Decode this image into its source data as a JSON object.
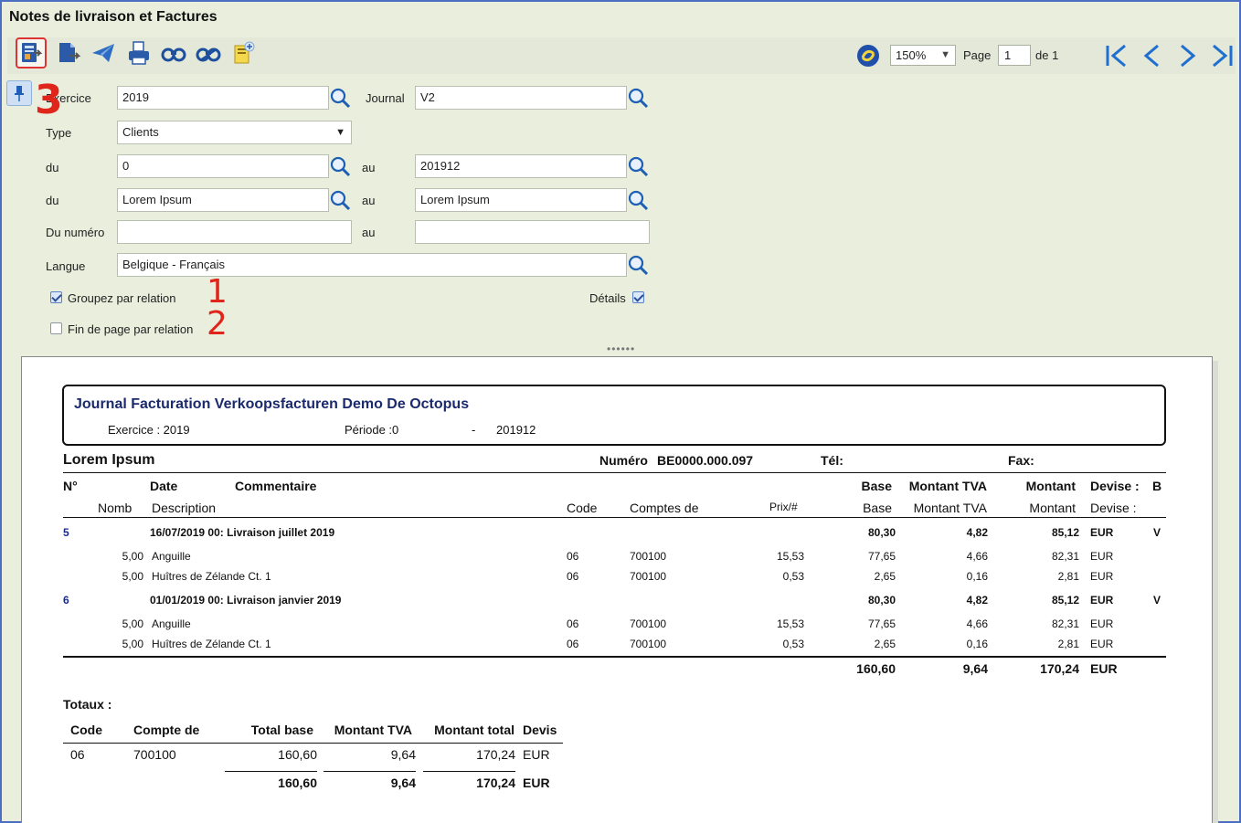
{
  "window": {
    "title": "Notes de livraison et Factures"
  },
  "toolbar": {
    "buttons": [
      {
        "icon": "export-report-icon",
        "active": true
      },
      {
        "icon": "export-file-icon"
      },
      {
        "icon": "send-icon"
      },
      {
        "icon": "print-icon"
      },
      {
        "icon": "preview-icon"
      },
      {
        "icon": "preview-all-icon"
      },
      {
        "icon": "new-document-icon"
      }
    ],
    "zoom": "150%",
    "page_label": "Page",
    "page_value": "1",
    "page_of": "de 1"
  },
  "filters": {
    "exercice_label": "Exercice",
    "exercice_value": "2019",
    "journal_label": "Journal",
    "journal_value": "V2",
    "type_label": "Type",
    "type_value": "Clients",
    "du1_label": "du",
    "du1_value": "0",
    "au1_label": "au",
    "au1_value": "201912",
    "du2_label": "du",
    "du2_value": "Lorem Ipsum",
    "au2_label": "au",
    "au2_value": "Lorem Ipsum",
    "dunum_label": "Du numéro",
    "dunum_value": "",
    "aunum_label": "au",
    "aunum_value": "",
    "langue_label": "Langue",
    "langue_value": "Belgique - Français",
    "groupez_label": "Groupez par relation",
    "groupez_checked": true,
    "details_label": "Détails",
    "details_checked": true,
    "finpage_label": "Fin de page par relation",
    "finpage_checked": false
  },
  "annotations": {
    "one": "1",
    "two": "2",
    "three": "3"
  },
  "report": {
    "title": "Journal Facturation Verkoopsfacturen Demo De Octopus",
    "exercice": "Exercice : 2019",
    "periode": "Période :0",
    "dash": "-",
    "periode_end": "201912",
    "relation": "Lorem Ipsum",
    "numero_label": "Numéro",
    "numero_value": "BE0000.000.097",
    "tel_label": "Tél:",
    "fax_label": "Fax:",
    "headers": {
      "no": "N°",
      "date": "Date",
      "commentaire": "Commentaire",
      "base": "Base",
      "montant_tva": "Montant TVA",
      "montant": "Montant",
      "devise": "Devise :",
      "b": "B",
      "nomb": "Nomb",
      "description": "Description",
      "code": "Code",
      "comptes": "Comptes de",
      "prix": "Prix/#",
      "base2": "Base",
      "montant_tva2": "Montant TVA",
      "montant2": "Montant",
      "devise2": "Devise :"
    },
    "documents": [
      {
        "no": "5",
        "header": "16/07/2019 00:  Livraison juillet 2019",
        "base": "80,30",
        "tva": "4,82",
        "montant": "85,12",
        "devise": "EUR",
        "b": "V",
        "lines": [
          {
            "qty": "5,00",
            "desc": "Anguille",
            "code": "06",
            "compte": "700100",
            "prix": "15,53",
            "base": "77,65",
            "tva": "4,66",
            "montant": "82,31",
            "devise": "EUR"
          },
          {
            "qty": "5,00",
            "desc": "Huîtres de Zélande Ct. 1",
            "code": "06",
            "compte": "700100",
            "prix": "0,53",
            "base": "2,65",
            "tva": "0,16",
            "montant": "2,81",
            "devise": "EUR"
          }
        ]
      },
      {
        "no": "6",
        "header": "01/01/2019 00:  Livraison janvier 2019",
        "base": "80,30",
        "tva": "4,82",
        "montant": "85,12",
        "devise": "EUR",
        "b": "V",
        "lines": [
          {
            "qty": "5,00",
            "desc": "Anguille",
            "code": "06",
            "compte": "700100",
            "prix": "15,53",
            "base": "77,65",
            "tva": "4,66",
            "montant": "82,31",
            "devise": "EUR"
          },
          {
            "qty": "5,00",
            "desc": "Huîtres de Zélande Ct. 1",
            "code": "06",
            "compte": "700100",
            "prix": "0,53",
            "base": "2,65",
            "tva": "0,16",
            "montant": "2,81",
            "devise": "EUR"
          }
        ]
      }
    ],
    "total": {
      "base": "160,60",
      "tva": "9,64",
      "montant": "170,24",
      "devise": "EUR"
    },
    "totaux": {
      "label": "Totaux :",
      "headers": {
        "code": "Code",
        "compte": "Compte de",
        "base": "Total base",
        "tva": "Montant TVA",
        "total": "Montant total",
        "devis": "Devis"
      },
      "row": {
        "code": "06",
        "compte": "700100",
        "base": "160,60",
        "tva": "9,64",
        "total": "170,24",
        "devis": "EUR"
      },
      "sum": {
        "base": "160,60",
        "tva": "9,64",
        "total": "170,24",
        "devis": "EUR"
      }
    }
  }
}
